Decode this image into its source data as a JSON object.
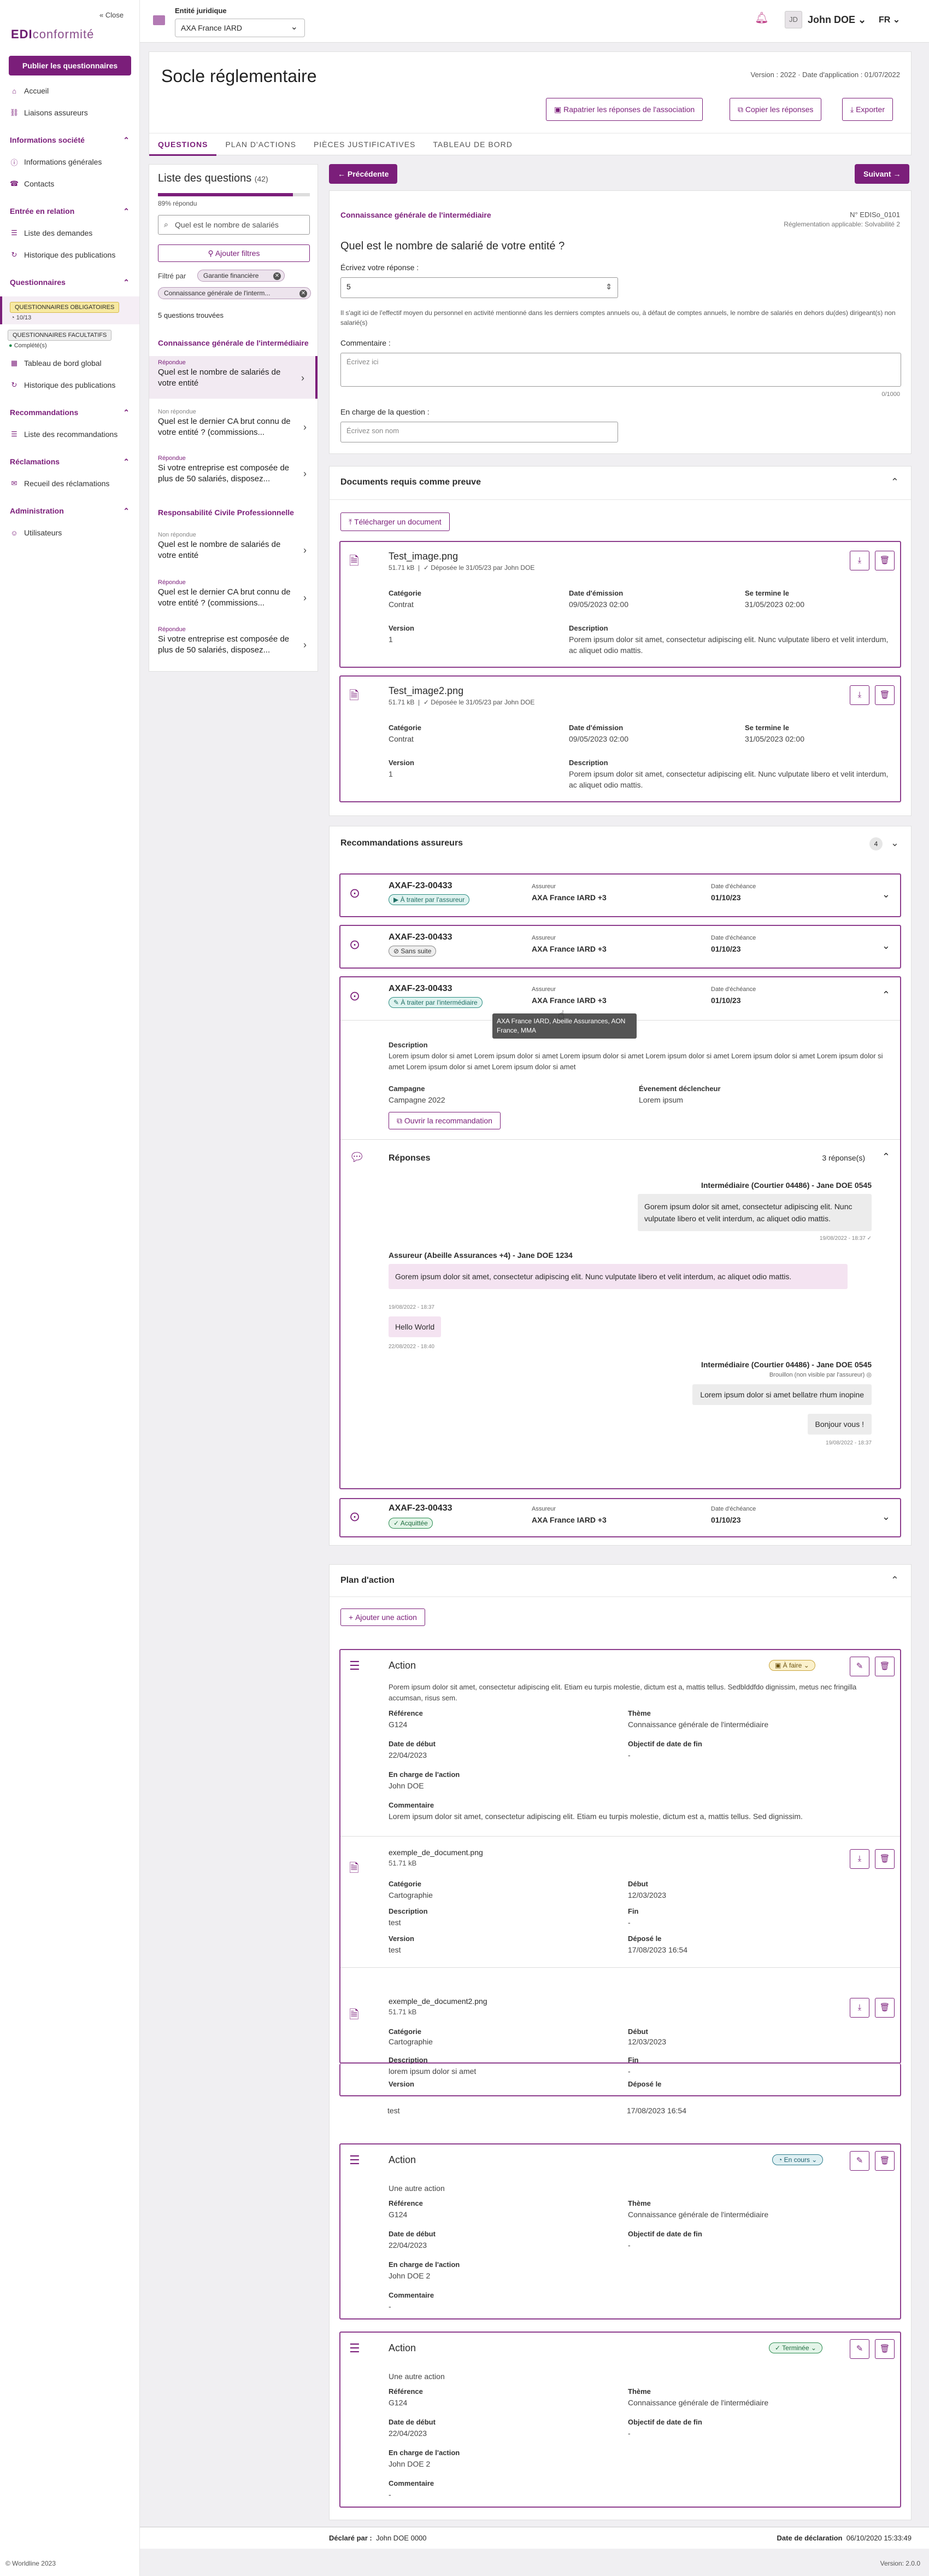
{
  "sidebar": {
    "close": "Close",
    "logo_a": "EDI",
    "logo_b": "conformité",
    "publish": "Publier les questionnaires",
    "home": "Accueil",
    "links": "Liaisons assureurs",
    "sec_info": "Informations société",
    "general": "Informations générales",
    "contacts": "Contacts",
    "sec_relation": "Entrée en relation",
    "requests": "Liste des demandes",
    "history_pub": "Historique des publications",
    "sec_quest": "Questionnaires",
    "mandatory": "QUESTIONNAIRES OBLIGATOIRES",
    "mandatory_count": "10/13",
    "optional": "QUESTIONNAIRES FACULTATIFS",
    "completed": "Complété(s)",
    "dashboard": "Tableau de bord global",
    "history_pub2": "Historique des publications",
    "sec_reco": "Recommandations",
    "reco_list": "Liste des recommandations",
    "sec_claims": "Réclamations",
    "claims": "Recueil des réclamations",
    "sec_admin": "Administration",
    "users": "Utilisateurs",
    "copyright": "© Worldline 2023"
  },
  "topbar": {
    "entity_label": "Entité juridique",
    "entity_value": "AXA France IARD",
    "avatar": "JD",
    "user": "John DOE",
    "lang": "FR"
  },
  "header": {
    "title": "Socle réglementaire",
    "version": "Version : 2022 · Date d'application : 01/07/2022",
    "btn_repatriate": "Rapatrier les réponses de l'association",
    "btn_copy": "Copier les réponses",
    "btn_export": "Exporter",
    "tabs": [
      "QUESTIONS",
      "PLAN D'ACTIONS",
      "PIÈCES JUSTIFICATIVES",
      "TABLEAU DE BORD"
    ]
  },
  "qlist": {
    "title": "Liste des questions",
    "count": "(42)",
    "progress": 0.89,
    "progress_text": "89% répondu",
    "search": "Quel est le nombre de salariés",
    "filter_btn": "Ajouter filtres",
    "filtered_by": "Filtré par",
    "chip1": "Garantie financière",
    "chip2": "Connaissance générale de l'interm...",
    "found": "5 questions trouvées",
    "cat1": "Connaissance générale de l'intermédiaire",
    "cat2": "Responsabilité Civile Professionnelle",
    "items": [
      {
        "status": "Répondue",
        "text": "Quel est le nombre de salariés de votre entité"
      },
      {
        "status": "Non répondue",
        "text": "Quel est le dernier CA brut connu de votre entité ? (commissions..."
      },
      {
        "status": "Répondue",
        "text": "Si votre entreprise est composée de plus de 50 salariés, disposez..."
      },
      {
        "status": "Non répondue",
        "text": "Quel est le nombre de salariés de votre entité"
      },
      {
        "status": "Répondue",
        "text": "Quel est le dernier CA brut connu de votre entité ? (commissions..."
      },
      {
        "status": "Répondue",
        "text": "Si votre entreprise est composée de plus de 50 salariés, disposez..."
      }
    ]
  },
  "question": {
    "prev": "Précédente",
    "next": "Suivant",
    "category": "Connaissance générale de l'intermédiaire",
    "ref": "N° EDISo_0101",
    "regulation": "Réglementation applicable: Solvabilité 2",
    "title": "Quel est le nombre de salarié de votre entité ?",
    "answer_label": "Écrivez votre réponse :",
    "answer": "5",
    "hint": "Il s'agit ici de l'effectif moyen du personnel en activité mentionné dans les derniers comptes annuels ou, à défaut de comptes annuels, le nombre de salariés en dehors du(des) dirigeant(s) non salarié(s)",
    "comment_label": "Commentaire :",
    "comment_ph": "Écrivez ici",
    "counter": "0/1000",
    "owner_label": "En charge de la question :",
    "owner_ph": "Écrivez son nom"
  },
  "docs": {
    "title": "Documents requis comme preuve",
    "upload": "Télécharger un document",
    "items": [
      {
        "name": "Test_image.png",
        "size": "51.71 kB",
        "uploaded": "Déposée le 31/05/23 par John DOE",
        "cat_l": "Catégorie",
        "cat": "Contrat",
        "em_l": "Date d'émission",
        "em": "09/05/2023 02:00",
        "end_l": "Se termine le",
        "end": "31/05/2023 02:00",
        "ver_l": "Version",
        "ver": "1",
        "desc_l": "Description",
        "desc": "Porem ipsum dolor sit amet, consectetur adipiscing elit. Nunc vulputate libero et velit interdum, ac aliquet odio mattis."
      },
      {
        "name": "Test_image2.png",
        "size": "51.71 kB",
        "uploaded": "Déposée le 31/05/23 par John DOE",
        "cat_l": "Catégorie",
        "cat": "Contrat",
        "em_l": "Date d'émission",
        "em": "09/05/2023 02:00",
        "end_l": "Se termine le",
        "end": "31/05/2023 02:00",
        "ver_l": "Version",
        "ver": "1",
        "desc_l": "Description",
        "desc": "Porem ipsum dolor sit amet, consectetur adipiscing elit. Nunc vulputate libero et velit interdum, ac aliquet odio mattis."
      }
    ]
  },
  "reco": {
    "title": "Recommandations assureurs",
    "count": "4",
    "labels": {
      "insurer": "Assureur",
      "due": "Date d'échéance"
    },
    "items": [
      {
        "id": "AXAF-23-00433",
        "status": "À traiter par l'assureur",
        "insurer": "AXA France IARD +3",
        "due": "01/10/23"
      },
      {
        "id": "AXAF-23-00433",
        "status": "Sans suite",
        "insurer": "AXA France IARD +3",
        "due": "01/10/23"
      },
      {
        "id": "AXAF-23-00433",
        "status": "À traiter par l'intermédiaire",
        "insurer": "AXA France IARD +3",
        "due": "01/10/23"
      },
      {
        "id": "AXAF-23-00433",
        "status": "Acquittée",
        "insurer": "AXA France IARD +3",
        "due": "01/10/23"
      }
    ],
    "tooltip": "AXA France IARD, Abeille Assurances, AON France, MMA",
    "desc_l": "Description",
    "desc": "Lorem ipsum dolor si amet Lorem ipsum dolor si amet Lorem ipsum dolor si amet Lorem ipsum dolor si amet Lorem ipsum dolor si amet Lorem ipsum dolor si amet Lorem ipsum dolor si amet Lorem ipsum dolor si amet",
    "camp_l": "Campagne",
    "camp": "Campagne 2022",
    "event_l": "Évenement déclencheur",
    "event": "Lorem ipsum",
    "open": "Ouvrir la recommandation",
    "responses": "Réponses",
    "responses_count": "3 réponse(s)",
    "msg1_author": "Intermédiaire (Courtier 04486) - Jane DOE 0545",
    "msg1": "Gorem ipsum dolor sit amet, consectetur adipiscing elit. Nunc vulputate libero et velit interdum, ac aliquet odio mattis.",
    "msg1_date": "19/08/2022 - 18:37",
    "msg2_author": "Assureur (Abeille Assurances +4) - Jane DOE 1234",
    "msg2": "Gorem ipsum dolor sit amet, consectetur adipiscing elit. Nunc vulputate libero et velit interdum, ac aliquet odio mattis.",
    "msg2_date": "19/08/2022 - 18:37",
    "msg3": "Hello World",
    "msg3_date": "22/08/2022 - 18:40",
    "msg4_author": "Intermédiaire (Courtier 04486) - Jane DOE 0545",
    "draft": "Brouillon (non visible par l'assureur)",
    "msg4": "Lorem ipsum dolor si amet bellatre rhum inopine",
    "msg5": "Bonjour vous !",
    "msg5_date": "19/08/2022 - 18:37"
  },
  "plan": {
    "title": "Plan d'action",
    "add": "Ajouter une action",
    "labels": {
      "ref": "Référence",
      "theme": "Thème",
      "start": "Date de début",
      "objective": "Objectif de date de fin",
      "owner": "En charge de l'action",
      "comment": "Commentaire",
      "cat": "Catégorie",
      "debut": "Début",
      "desc": "Description",
      "fin": "Fin",
      "version": "Version",
      "deposit": "Déposé le"
    },
    "actions": [
      {
        "title": "Action",
        "status": "À faire",
        "desc": "Porem ipsum dolor sit amet, consectetur adipiscing elit. Etiam eu turpis molestie, dictum est a, mattis tellus. Sedblddfdo dignissim, metus nec fringilla accumsan, risus sem.",
        "ref": "G124",
        "theme": "Connaissance générale de l'intermédiaire",
        "start": "22/04/2023",
        "objective": "-",
        "owner": "John DOE",
        "comment": "Lorem ipsum dolor sit amet, consectetur adipiscing elit. Etiam eu turpis molestie, dictum est a, mattis tellus. Sed dignissim."
      },
      {
        "title": "Action",
        "status": "En cours",
        "desc": "Une autre action",
        "ref": "G124",
        "theme": "Connaissance générale de l'intermédiaire",
        "start": "22/04/2023",
        "objective": "-",
        "owner": "John DOE 2",
        "comment": "-"
      },
      {
        "title": "Action",
        "status": "Terminée",
        "desc": "Une autre action",
        "ref": "G124",
        "theme": "Connaissance générale de l'intermédiaire",
        "start": "22/04/2023",
        "objective": "-",
        "owner": "John DOE 2",
        "comment": "-"
      }
    ],
    "docs": [
      {
        "name": "exemple_de_document.png",
        "size": "51.71 kB",
        "cat": "Cartographie",
        "debut": "12/03/2023",
        "desc": "test",
        "fin": "-",
        "version": "test",
        "deposit": "17/08/2023 16:54"
      },
      {
        "name": "exemple_de_document2.png",
        "size": "51.71 kB",
        "cat": "Cartographie",
        "debut": "12/03/2023",
        "desc": "lorem ipsum dolor si amet",
        "fin": "-",
        "version": "test",
        "deposit": "17/08/2023 16:54"
      }
    ]
  },
  "footer": {
    "declared_l": "Déclaré par :",
    "declared": "John DOE 0000",
    "date_l": "Date de déclaration",
    "date": "06/10/2020 15:33:49",
    "version": "Version: 2.0.0"
  }
}
